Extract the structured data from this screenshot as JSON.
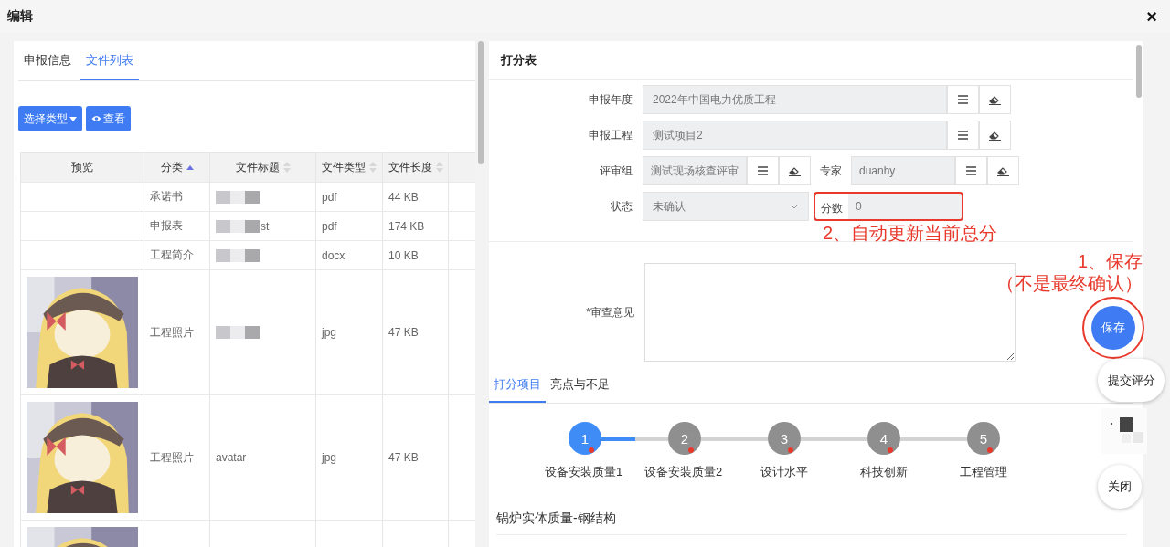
{
  "dialog": {
    "title": "编辑",
    "close": "×"
  },
  "left_panel": {
    "tabs": [
      {
        "label": "申报信息",
        "selected": false
      },
      {
        "label": "文件列表",
        "selected": true
      }
    ],
    "buttons": [
      {
        "label": "选择类型",
        "kind": "dropdown"
      },
      {
        "label": "查看",
        "kind": "view"
      }
    ],
    "table": {
      "columns": [
        {
          "label": "预览",
          "kind": "plain"
        },
        {
          "label": "分类",
          "kind": "sorted"
        },
        {
          "label": "文件标题",
          "kind": "sortable"
        },
        {
          "label": "文件类型",
          "kind": "sortable"
        },
        {
          "label": "文件长度",
          "kind": "sortable"
        }
      ],
      "rows": [
        {
          "kind": "document",
          "category": "承诺书",
          "redacted": true,
          "type": "pdf",
          "size": "44 KB"
        },
        {
          "kind": "document",
          "category": "申报表",
          "title": "st",
          "redacted": true,
          "type": "pdf",
          "size": "174 KB"
        },
        {
          "kind": "document",
          "category": "工程简介",
          "redacted": true,
          "type": "docx",
          "size": "10 KB"
        },
        {
          "kind": "picture",
          "category": "工程照片",
          "redacted": true,
          "type": "jpg",
          "size": "47 KB"
        },
        {
          "kind": "picture",
          "category": "工程照片",
          "title": "avatar",
          "redacted": false,
          "type": "jpg",
          "size": "47 KB"
        },
        {
          "kind": "picture",
          "redacted": false
        }
      ]
    }
  },
  "score_form": {
    "title": "打分表",
    "rows": [
      [
        {
          "label": "申报年度",
          "value": "2022年中国电力优质工程",
          "kind": "lookup",
          "annotated": false
        }
      ],
      [
        {
          "label": "申报工程",
          "value": "测试项目2",
          "kind": "lookup",
          "annotated": false
        }
      ],
      [
        {
          "label": "评审组",
          "value": "测试现场核查评审",
          "kind": "lookup",
          "annotated": false
        },
        {
          "label": "专家",
          "value": "duanhy",
          "kind": "lookup",
          "annotated": false
        }
      ],
      [
        {
          "label": "状态",
          "value": "未确认",
          "kind": "select",
          "annotated": false
        },
        {
          "label": "分数",
          "value": "0",
          "kind": "readonly",
          "annotated": true
        }
      ]
    ],
    "review": {
      "label": "*审查意见"
    },
    "tabs": [
      {
        "label": "打分项目",
        "selected": true
      },
      {
        "label": "亮点与不足",
        "selected": false
      }
    ],
    "steps": [
      {
        "number": "1",
        "label": "设备安装质量1",
        "selected": true,
        "flagged": true
      },
      {
        "number": "2",
        "label": "设备安装质量2",
        "selected": false,
        "flagged": true
      },
      {
        "number": "3",
        "label": "设计水平",
        "selected": false,
        "flagged": true
      },
      {
        "number": "4",
        "label": "科技创新",
        "selected": false,
        "flagged": true
      },
      {
        "number": "5",
        "label": "工程管理",
        "selected": false,
        "flagged": true
      }
    ],
    "section_title": "锅炉实体质量-钢结构"
  },
  "floating_actions": [
    {
      "label": "保存",
      "kind": "primary",
      "annotated": true
    },
    {
      "label": "提交评分",
      "kind": "pill",
      "annotated": false
    },
    {
      "kind": "qr",
      "annotated": false
    },
    {
      "label": "关闭",
      "kind": "round",
      "annotated": false
    }
  ],
  "annotations": [
    {
      "lines": [
        "2、自动更新当前总分"
      ]
    },
    {
      "lines": [
        "1、保存",
        "（不是最终确认）"
      ]
    }
  ]
}
